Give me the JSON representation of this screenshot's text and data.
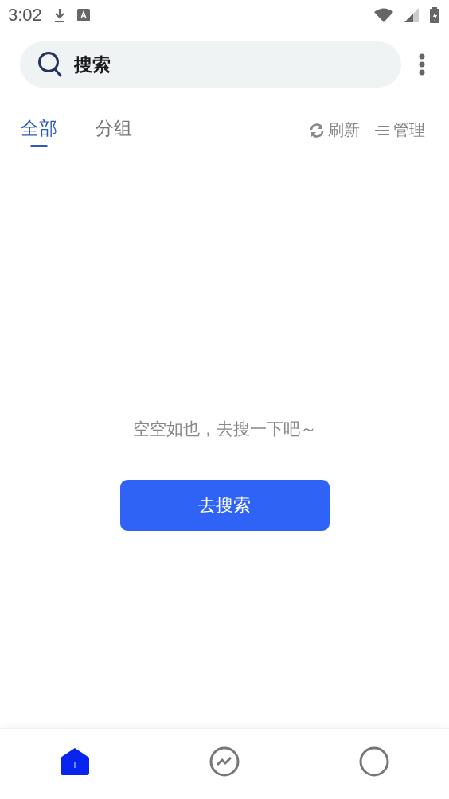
{
  "status_bar": {
    "time": "3:02"
  },
  "search": {
    "placeholder": "搜索"
  },
  "tabs": [
    {
      "label": "全部",
      "selected": true
    },
    {
      "label": "分组",
      "selected": false
    }
  ],
  "actions": [
    {
      "kind": "refresh",
      "label": "刷新"
    },
    {
      "kind": "manage",
      "label": "管理"
    }
  ],
  "empty_state": {
    "message": "空空如也，去搜一下吧～",
    "button": "去搜索"
  },
  "bottom_nav": [
    {
      "kind": "home",
      "selected": true
    },
    {
      "kind": "trend",
      "selected": false
    },
    {
      "kind": "profile",
      "selected": false
    }
  ]
}
